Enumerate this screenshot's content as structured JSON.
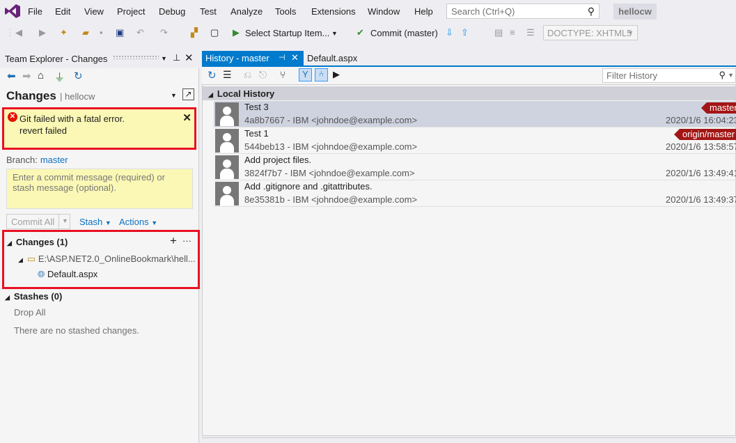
{
  "menu": [
    "File",
    "Edit",
    "View",
    "Project",
    "Debug",
    "Test",
    "Analyze",
    "Tools",
    "Extensions",
    "Window",
    "Help"
  ],
  "search": {
    "placeholder": "Search (Ctrl+Q)"
  },
  "user": "hellocw",
  "toolbar": {
    "startup": "Select Startup Item...",
    "commit": "Commit (master)",
    "doctype": "DOCTYPE: XHTML5"
  },
  "team_explorer": {
    "title": "Team Explorer - Changes",
    "heading": "Changes",
    "repo": "hellocw",
    "error_line1": "Git failed with a fatal error.",
    "error_line2": "revert failed",
    "branch_label": "Branch:",
    "branch": "master",
    "commit_placeholder": "Enter a commit message (required) or stash message (optional).",
    "commit_all": "Commit All",
    "stash": "Stash",
    "actions": "Actions",
    "changes_section": "Changes (1)",
    "folder": "E:\\ASP.NET2.0_OnlineBookmark\\hell...",
    "file": "Default.aspx",
    "stashes_section": "Stashes (0)",
    "drop_all": "Drop All",
    "no_stash": "There are no stashed changes."
  },
  "tabs": {
    "active": "History - master",
    "inactive": "Default.aspx"
  },
  "history": {
    "filter_placeholder": "Filter History",
    "group": "Local History",
    "commits": [
      {
        "msg": "Test 3",
        "meta": "4a8b7667 - IBM <johndoe@example.com>",
        "date": "2020/1/6 16:04:23",
        "ref": "master"
      },
      {
        "msg": "Test 1",
        "meta": "544beb13 - IBM <johndoe@example.com>",
        "date": "2020/1/6 13:58:57",
        "ref": "origin/master"
      },
      {
        "msg": "Add project files.",
        "meta": "3824f7b7 - IBM <johndoe@example.com>",
        "date": "2020/1/6 13:49:41",
        "ref": ""
      },
      {
        "msg": "Add .gitignore and .gitattributes.",
        "meta": "8e35381b - IBM <johndoe@example.com>",
        "date": "2020/1/6 13:49:37",
        "ref": ""
      }
    ]
  },
  "colors": {
    "accent": "#007acc",
    "error_border": "#e81123",
    "warning_bg": "#fbf8b5",
    "ref_bg": "#a31515"
  }
}
